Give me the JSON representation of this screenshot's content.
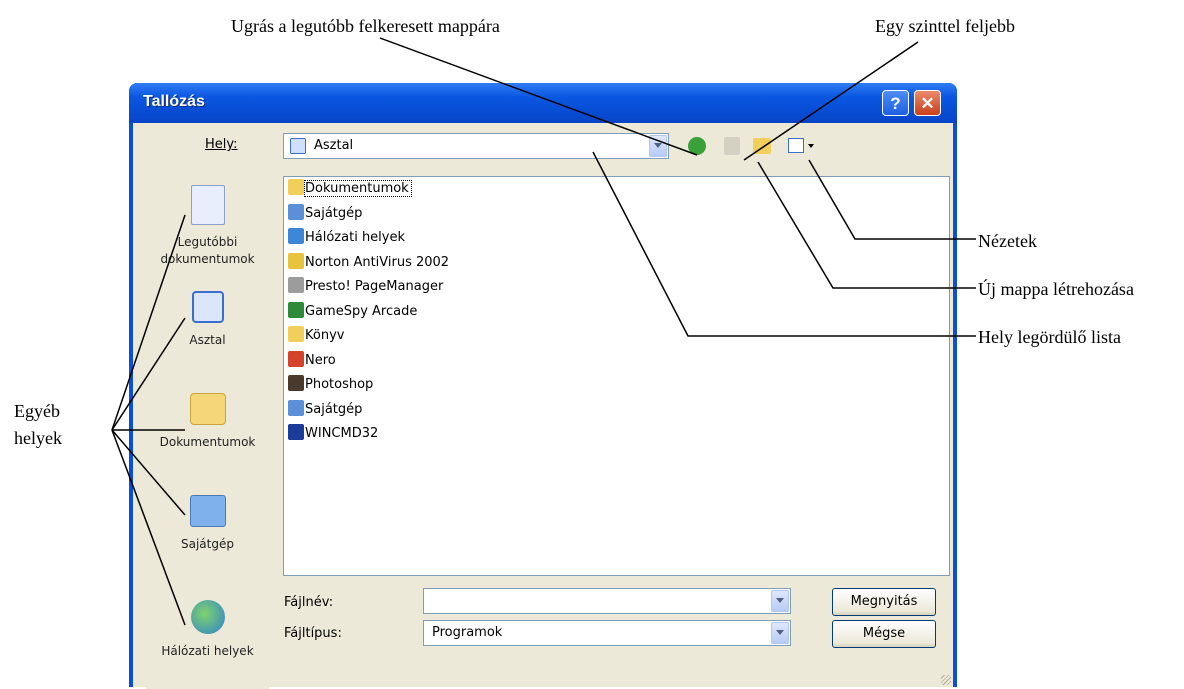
{
  "annotations": {
    "goto_last": "Ugrás a legutóbb felkeresett mappára",
    "up_one_level": "Egy szinttel feljebb",
    "views": "Nézetek",
    "new_folder": "Új mappa létrehozása",
    "location_dropdown": "Hely legördülő lista",
    "other_places_line1": "Egyéb",
    "other_places_line2": "helyek"
  },
  "dialog": {
    "title": "Tallózás",
    "help_glyph": "?",
    "close_glyph": "✕",
    "location_label": "Hely:",
    "location_value": "Asztal"
  },
  "places": [
    {
      "label_line1": "Legutóbbi",
      "label_line2": "dokumentumok",
      "icon": "recent-documents-icon"
    },
    {
      "label_line1": "Asztal",
      "label_line2": "",
      "icon": "desktop-icon"
    },
    {
      "label_line1": "Dokumentumok",
      "label_line2": "",
      "icon": "documents-folder-icon"
    },
    {
      "label_line1": "Sajátgép",
      "label_line2": "",
      "icon": "my-computer-icon"
    },
    {
      "label_line1": "Hálózati helyek",
      "label_line2": "",
      "icon": "network-places-icon"
    }
  ],
  "files": [
    {
      "name": "Dokumentumok",
      "icon": "folder-icon",
      "color": "#f2cf5b"
    },
    {
      "name": "Sajátgép",
      "icon": "computer-icon",
      "color": "#5b8fd8"
    },
    {
      "name": "Hálózati helyek",
      "icon": "network-icon",
      "color": "#3d87d6"
    },
    {
      "name": "Norton AntiVirus 2002",
      "icon": "shortcut-icon",
      "color": "#e8c43c"
    },
    {
      "name": "Presto! PageManager",
      "icon": "shortcut-icon",
      "color": "#9c9c9c"
    },
    {
      "name": "GameSpy Arcade",
      "icon": "gamespy-icon",
      "color": "#2e8b3a"
    },
    {
      "name": "Könyv",
      "icon": "folder-shortcut-icon",
      "color": "#f2cf5b"
    },
    {
      "name": "Nero",
      "icon": "shortcut-icon",
      "color": "#d6432b"
    },
    {
      "name": "Photoshop",
      "icon": "shortcut-icon",
      "color": "#4a3a2e"
    },
    {
      "name": "Sajátgép",
      "icon": "computer-shortcut-icon",
      "color": "#5b8fd8"
    },
    {
      "name": "WINCMD32",
      "icon": "shortcut-icon",
      "color": "#1c3c9a"
    }
  ],
  "filename": {
    "label": "Fájlnév:",
    "value": ""
  },
  "filetype": {
    "label": "Fájltípus:",
    "value": "Programok"
  },
  "buttons": {
    "open": "Megnyitás",
    "cancel": "Mégse"
  }
}
